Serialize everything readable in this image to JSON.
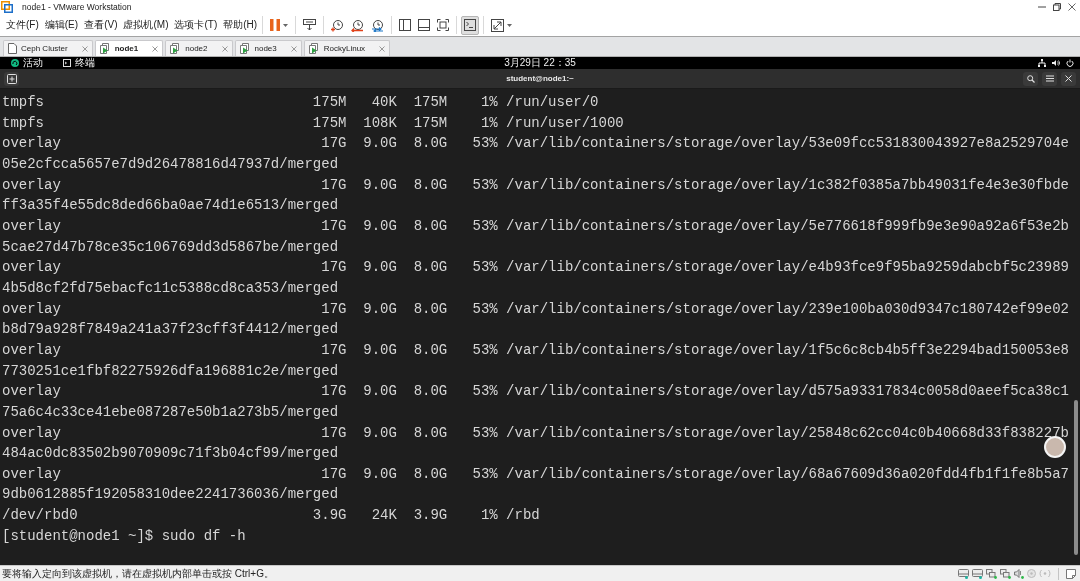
{
  "window": {
    "title": "node1 - VMware Workstation"
  },
  "menu": [
    "文件(F)",
    "编辑(E)",
    "查看(V)",
    "虚拟机(M)",
    "选项卡(T)",
    "帮助(H)"
  ],
  "toolbar": [
    {
      "items": [
        {
          "kind": "pause",
          "dropdown": true,
          "selected": false
        }
      ]
    },
    {
      "items": [
        {
          "kind": "send-keys",
          "dropdown": false,
          "selected": false
        }
      ]
    },
    {
      "items": [
        {
          "kind": "snapshot",
          "dropdown": false,
          "selected": false
        },
        {
          "kind": "revert",
          "dropdown": false,
          "selected": false
        },
        {
          "kind": "snapshot-manager",
          "dropdown": false,
          "selected": false
        }
      ]
    },
    {
      "items": [
        {
          "kind": "library",
          "dropdown": false,
          "selected": false
        },
        {
          "kind": "thumbnails",
          "dropdown": false,
          "selected": false
        },
        {
          "kind": "full-screen",
          "dropdown": false,
          "selected": false
        }
      ]
    },
    {
      "items": [
        {
          "kind": "console",
          "dropdown": false,
          "selected": true
        }
      ]
    },
    {
      "items": [
        {
          "kind": "stretch",
          "dropdown": true,
          "selected": false
        }
      ]
    }
  ],
  "tabs": [
    {
      "label": "Ceph Cluster",
      "kind": "team",
      "selected": false
    },
    {
      "label": "node1",
      "kind": "vm",
      "selected": true
    },
    {
      "label": "node2",
      "kind": "vm",
      "selected": false
    },
    {
      "label": "node3",
      "kind": "vm",
      "selected": false
    },
    {
      "label": "RockyLinux",
      "kind": "vm",
      "selected": false
    }
  ],
  "guest": {
    "top_bar": {
      "activities": "活动",
      "app": "终端",
      "clock": "3月29日 22：35"
    },
    "terminal": {
      "title": "student@node1:~",
      "lines": [
        "tmpfs                                175M   40K  175M    1% /run/user/0",
        "tmpfs                                175M  108K  175M    1% /run/user/1000",
        "overlay                               17G  9.0G  8.0G   53% /var/lib/containers/storage/overlay/53e09fcc531830043927e8a2529704e",
        "05e2cfcca5657e7d9d26478816d47937d/merged",
        "overlay                               17G  9.0G  8.0G   53% /var/lib/containers/storage/overlay/1c382f0385a7bb49031fe4e3e30fbde",
        "ff3a35f4e55dc8ded66ba0ae74d1e6513/merged",
        "overlay                               17G  9.0G  8.0G   53% /var/lib/containers/storage/overlay/5e776618f999fb9e3e90a92a6f53e2b",
        "5cae27d47b78ce35c106769dd3d5867be/merged",
        "overlay                               17G  9.0G  8.0G   53% /var/lib/containers/storage/overlay/e4b93fce9f95ba9259dabcbf5c23989",
        "4b5d8cf2fd75ebacfc11c5388cd8ca353/merged",
        "overlay                               17G  9.0G  8.0G   53% /var/lib/containers/storage/overlay/239e100ba030d9347c180742ef99e02",
        "b8d79a928f7849a241a37f23cff3f4412/merged",
        "overlay                               17G  9.0G  8.0G   53% /var/lib/containers/storage/overlay/1f5c6c8cb4b5ff3e2294bad150053e8",
        "7730251ce1fbf82275926dfa196881c2e/merged",
        "overlay                               17G  9.0G  8.0G   53% /var/lib/containers/storage/overlay/d575a93317834c0058d0aeef5ca38c1",
        "75a6c4c33ce41ebe087287e50b1a273b5/merged",
        "overlay                               17G  9.0G  8.0G   53% /var/lib/containers/storage/overlay/25848c62cc04c0b40668d33f838227b",
        "484ac0dc83502b9070909c71f3b04cf99/merged",
        "overlay                               17G  9.0G  8.0G   53% /var/lib/containers/storage/overlay/68a67609d36a020fdd4fb1f1fe8b5a7",
        "9db0612885f192058310dee2241736036/merged",
        "/dev/rbd0                            3.9G   24K  3.9G    1% /rbd",
        "[student@node1 ~]$ sudo df -h"
      ]
    }
  },
  "status_bar": {
    "message": "要将输入定向到该虚拟机，请在虚拟机内部单击或按 Ctrl+G。"
  }
}
